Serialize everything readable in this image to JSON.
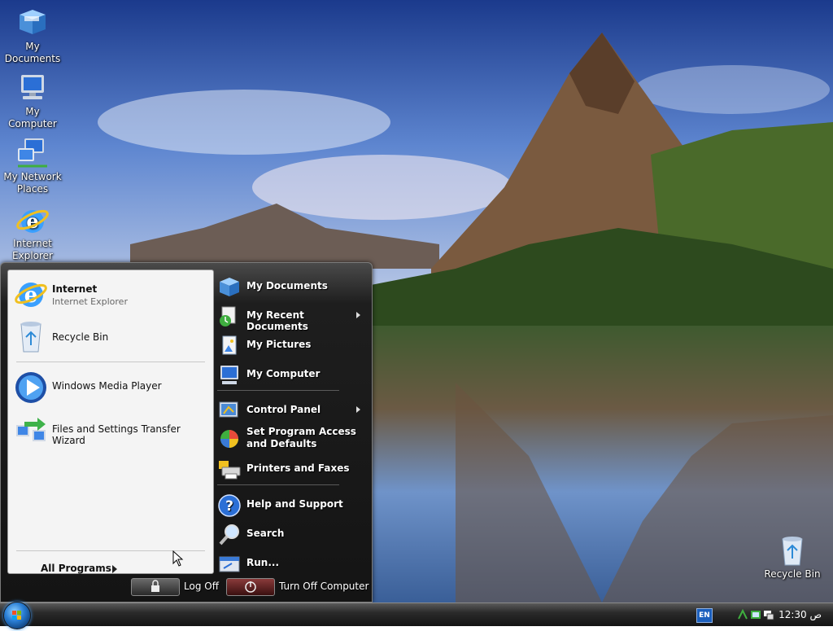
{
  "desktop": {
    "icons": [
      {
        "label": "My Documents",
        "icon": "my-documents-icon"
      },
      {
        "label": "My Computer",
        "icon": "my-computer-icon"
      },
      {
        "label": "My Network Places",
        "icon": "network-places-icon"
      },
      {
        "label": "Internet Explorer",
        "icon": "internet-explorer-icon"
      },
      {
        "label": "Recycle Bin",
        "icon": "recycle-bin-icon"
      }
    ]
  },
  "start_menu": {
    "left": {
      "pinned": [
        {
          "title": "Internet",
          "subtitle": "Internet Explorer",
          "icon": "internet-explorer-icon"
        },
        {
          "title": "Recycle Bin",
          "icon": "recycle-bin-icon"
        }
      ],
      "recent": [
        {
          "title": "Windows Media Player",
          "icon": "media-player-icon"
        },
        {
          "title": "Files and Settings Transfer Wizard",
          "icon": "transfer-wizard-icon"
        }
      ],
      "all_programs": "All Programs"
    },
    "right": {
      "items": [
        {
          "label": "My Documents",
          "icon": "my-documents-icon",
          "submenu": false
        },
        {
          "label": "My Recent Documents",
          "icon": "recent-documents-icon",
          "submenu": true
        },
        {
          "label": "My Pictures",
          "icon": "my-pictures-icon",
          "submenu": false
        },
        {
          "label": "My Computer",
          "icon": "my-computer-icon",
          "submenu": false
        },
        {
          "label": "Control Panel",
          "icon": "control-panel-icon",
          "submenu": true
        },
        {
          "label": "Set Program Access and Defaults",
          "icon": "program-access-icon",
          "submenu": false
        },
        {
          "label": "Printers and Faxes",
          "icon": "printer-icon",
          "submenu": false
        },
        {
          "label": "Help and Support",
          "icon": "help-icon",
          "submenu": false
        },
        {
          "label": "Search",
          "icon": "search-icon",
          "submenu": false
        },
        {
          "label": "Run...",
          "icon": "run-icon",
          "submenu": false
        }
      ]
    },
    "log_off": "Log Off",
    "turn_off": "Turn Off Computer"
  },
  "taskbar": {
    "language": "EN",
    "clock": "12:30 ص"
  }
}
